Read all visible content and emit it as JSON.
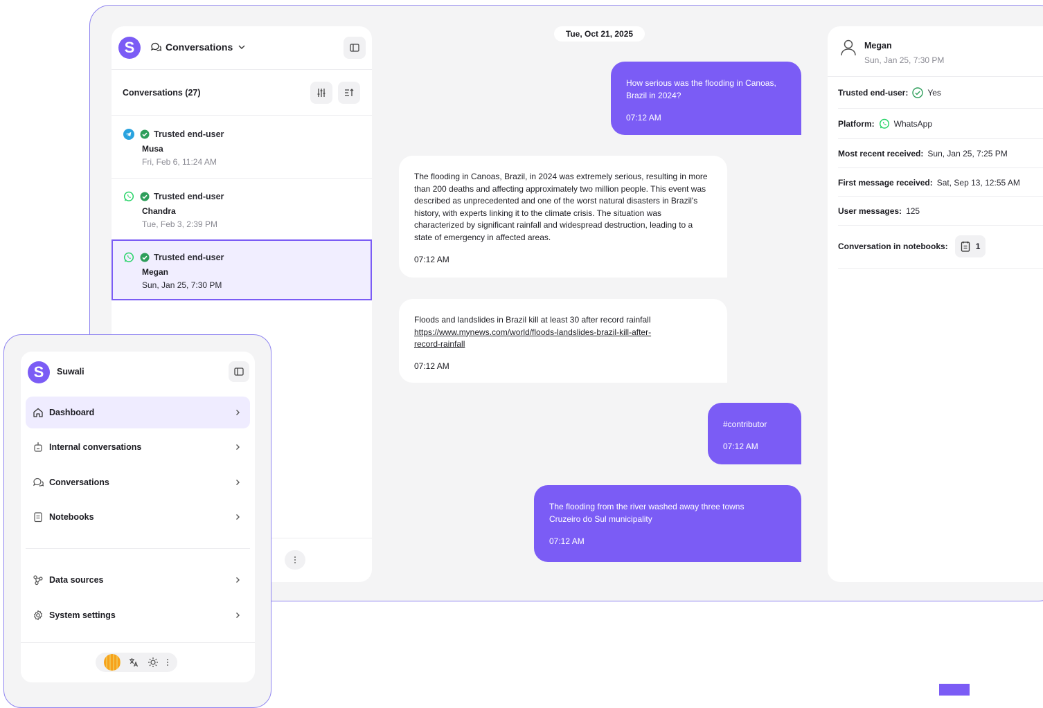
{
  "header": {
    "app_letter": "S",
    "view_title": "Conversations"
  },
  "conversations": {
    "title": "Conversations (27)",
    "items": [
      {
        "platform": "telegram",
        "badge": "Trusted end-user",
        "name": "Musa",
        "time": "Fri, Feb 6, 11:24 AM"
      },
      {
        "platform": "whatsapp",
        "badge": "Trusted end-user",
        "name": "Chandra",
        "time": "Tue, Feb 3, 2:39 PM"
      },
      {
        "platform": "whatsapp",
        "badge": "Trusted end-user",
        "name": "Megan",
        "time": "Sun, Jan 25, 7:30 PM"
      }
    ]
  },
  "chat": {
    "date": "Tue, Oct 21, 2025",
    "messages": [
      {
        "direction": "out",
        "text": "How serious was the flooding in Canoas, Brazil in 2024?",
        "time": "07:12 AM"
      },
      {
        "direction": "in",
        "text": "The flooding in Canoas, Brazil, in 2024 was extremely serious, resulting in more than 200 deaths and affecting approximately two million people. This event was described as unprecedented and one of the worst natural disasters in Brazil's history, with experts linking it to the climate crisis. The situation was characterized by significant rainfall and widespread destruction, leading to a state of emergency in affected areas.",
        "time": "07:12 AM"
      },
      {
        "direction": "in",
        "text": "Floods and landslides in Brazil kill at least 30 after record rainfall",
        "link": "https://www.mynews.com/world/floods-landslides-brazil-kill-after-record-rainfall",
        "time": "07:12 AM"
      },
      {
        "direction": "out",
        "text": "#contributor",
        "time": "07:12 AM"
      },
      {
        "direction": "out",
        "text": "The flooding from the river washed away three towns Cruzeiro do Sul municipality",
        "time": "07:12 AM"
      }
    ]
  },
  "details": {
    "name": "Megan",
    "last_seen": "Sun, Jan 25, 7:30 PM",
    "trusted_label": "Trusted end-user:",
    "trusted_value": "Yes",
    "platform_label": "Platform:",
    "platform_value": "WhatsApp",
    "recent_label": "Most recent received:",
    "recent_value": "Sun, Jan 25, 7:25 PM",
    "first_label": "First message received:",
    "first_value": "Sat, Sep 13, 12:55 AM",
    "user_msgs_label": "User messages:",
    "user_msgs_value": "125",
    "notebooks_label": "Conversation in notebooks:",
    "notebooks_value": "1"
  },
  "sidebar": {
    "app_letter": "S",
    "app_name": "Suwali",
    "items": [
      {
        "label": "Dashboard",
        "icon": "home-icon",
        "active": true
      },
      {
        "label": "Internal conversations",
        "icon": "bot-icon"
      },
      {
        "label": "Conversations",
        "icon": "chat-bubbles-icon"
      },
      {
        "label": "Notebooks",
        "icon": "notebook-icon"
      },
      {
        "label": "Data sources",
        "icon": "data-sources-icon"
      },
      {
        "label": "System settings",
        "icon": "gear-icon"
      }
    ]
  },
  "colors": {
    "accent": "#7b5cf5",
    "whatsapp": "#25d366",
    "telegram": "#2aa3df",
    "verified": "#2e9e5b"
  }
}
